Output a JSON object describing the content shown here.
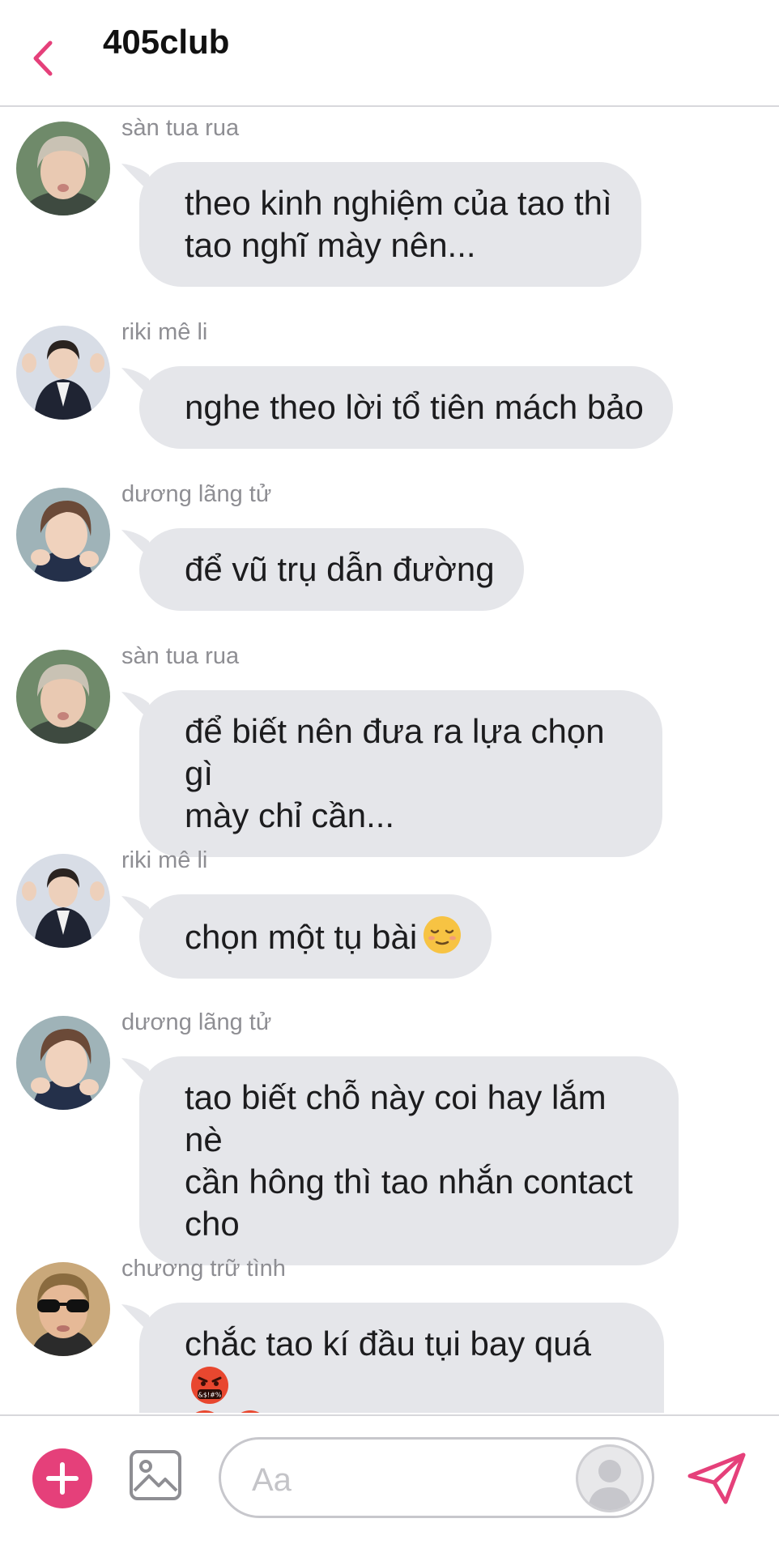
{
  "header": {
    "title": "405club"
  },
  "messages": [
    {
      "sender": "sàn tua rua",
      "text": "theo kinh nghiệm của tao thì\ntao nghĩ mày nên..."
    },
    {
      "sender": "riki mê li",
      "text": "nghe theo lời tổ tiên mách bảo"
    },
    {
      "sender": "dương lãng tử",
      "text": "để vũ trụ dẫn đường"
    },
    {
      "sender": "sàn tua rua",
      "text": "để biết nên đưa ra lựa chọn gì\nmày chỉ cần..."
    },
    {
      "sender": "riki mê li",
      "text": "chọn một tụ bài"
    },
    {
      "sender": "dương lãng tử",
      "text": "tao biết chỗ này coi hay lắm nè\ncần hông thì tao nhắn contact\ncho"
    },
    {
      "sender": "chương trữ tình",
      "text": "chắc tao kí đầu tụi bay quá"
    }
  ],
  "composer": {
    "placeholder": "Aa"
  },
  "icons": {
    "back": "chevron-left-icon",
    "add": "plus-icon",
    "image": "image-icon",
    "send": "paper-plane-icon",
    "relieved_emoji": "relieved-face-emoji",
    "angry_emoji": "face-with-symbols-on-mouth-emoji"
  },
  "colors": {
    "accent": "#e5407a",
    "bubble": "#e5e6ea",
    "sender_text": "#8e8e93"
  }
}
